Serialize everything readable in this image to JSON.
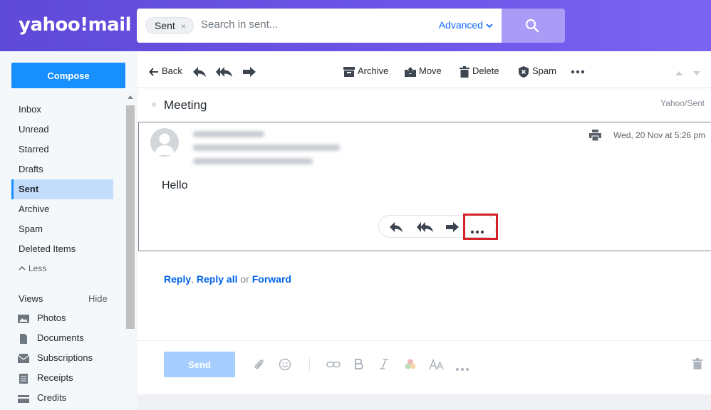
{
  "header": {
    "logo_text": "yahoo!mail",
    "search": {
      "chip_label": "Sent",
      "chip_close": "×",
      "placeholder": "Search in sent...",
      "advanced_label": "Advanced"
    }
  },
  "sidebar": {
    "compose_label": "Compose",
    "folders": [
      {
        "label": "Inbox"
      },
      {
        "label": "Unread"
      },
      {
        "label": "Starred"
      },
      {
        "label": "Drafts"
      },
      {
        "label": "Sent"
      },
      {
        "label": "Archive"
      },
      {
        "label": "Spam"
      },
      {
        "label": "Deleted Items"
      }
    ],
    "less_label": "Less",
    "views_label": "Views",
    "hide_label": "Hide",
    "views": [
      {
        "label": "Photos",
        "icon": "photos-icon"
      },
      {
        "label": "Documents",
        "icon": "documents-icon"
      },
      {
        "label": "Subscriptions",
        "icon": "subscriptions-icon"
      },
      {
        "label": "Receipts",
        "icon": "receipts-icon"
      },
      {
        "label": "Credits",
        "icon": "credits-icon"
      }
    ]
  },
  "toolbar": {
    "back_label": "Back",
    "archive_label": "Archive",
    "move_label": "Move",
    "delete_label": "Delete",
    "spam_label": "Spam"
  },
  "message": {
    "subject": "Meeting",
    "folder_path": "Yahoo/Sent",
    "date": "Wed, 20 Nov at 5:26 pm",
    "body": "Hello"
  },
  "reply": {
    "reply_label": "Reply",
    "comma": ",",
    "reply_all_label": "Reply all",
    "or_label": "or",
    "forward_label": "Forward"
  },
  "composer": {
    "send_label": "Send"
  },
  "colors": {
    "header_gradient_start": "#5f49d8",
    "header_gradient_end": "#7b64f2",
    "accent": "#188fff",
    "active_folder_bg": "#c2dcfc",
    "highlight_box": "#d4212a"
  }
}
